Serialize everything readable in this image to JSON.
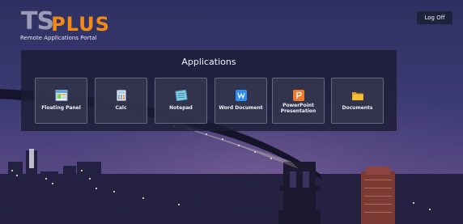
{
  "app": {
    "logo_ts": "TS",
    "logo_plus": "PLUS",
    "subtitle": "Remote Applications Portal",
    "logoff_label": "Log Off"
  },
  "panel": {
    "title": "Applications",
    "tiles": [
      {
        "label": "Floating Panel",
        "icon": "floating-panel-icon"
      },
      {
        "label": "Calc",
        "icon": "calculator-icon"
      },
      {
        "label": "Notepad",
        "icon": "notepad-icon"
      },
      {
        "label": "Word Document",
        "icon": "word-document-icon"
      },
      {
        "label": "PowerPoint Presentation",
        "icon": "powerpoint-icon"
      },
      {
        "label": "Documents",
        "icon": "folder-icon"
      }
    ]
  },
  "colors": {
    "brand_orange": "#f28a16",
    "logo_grey": "#9c9ab7",
    "panel_bg": "#1c1c34",
    "word_blue": "#2f8ff0",
    "powerpoint_orange": "#f07a2a",
    "folder_yellow": "#f3c030"
  }
}
